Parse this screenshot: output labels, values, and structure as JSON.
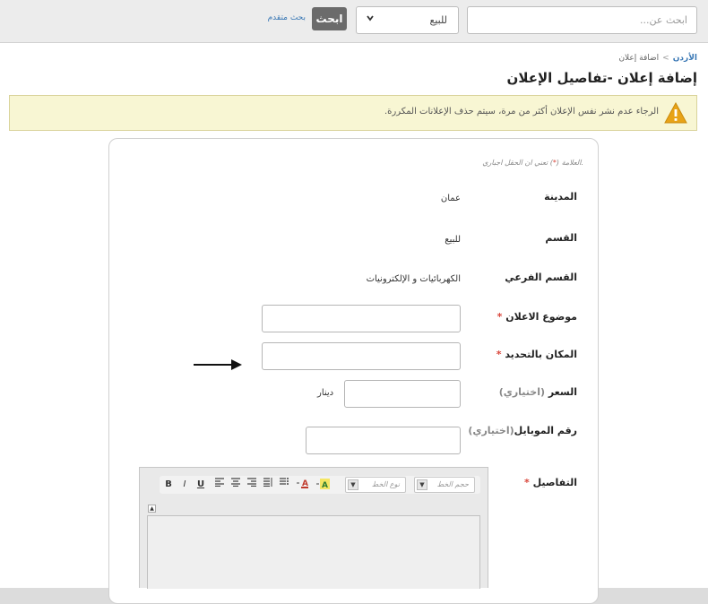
{
  "colors": {
    "accent": "#3a78b5",
    "required_star": "#d9463b",
    "warning_bg": "#f8f6d3",
    "search_button_bg": "#6b6b6b"
  },
  "search": {
    "placeholder": "ابحث عن...",
    "category_selected": "للبيع",
    "button_label": "ابحث",
    "advanced_link": "بحث متقدم"
  },
  "breadcrumb": {
    "home": "الأردن",
    "separator": ">",
    "current": "اضافة إعلان"
  },
  "page_title": "إضافة إعلان -تفاصيل الإعلان",
  "warning": {
    "icon": "warning-triangle-icon",
    "text": "الرجاء عدم نشر نفس الإعلان أكثر من مرة، سيتم حذف الإعلانات المكررة."
  },
  "form": {
    "required_note_prefix": "العلامة (",
    "required_note_star": "*",
    "required_note_suffix": ") تعني ان الحقل اجباري.",
    "city_label": "المدينة",
    "city_value": "عمان",
    "section_label": "القسم",
    "section_value": "للبيع",
    "subsection_label": "القسم الفرعي",
    "subsection_value": "الكهربائيات و الإلكترونيات",
    "title_label": "موضوع الاعلان",
    "location_label": "المكان بالتحديد",
    "price_label": "السعر",
    "price_optional": "(اختياري)",
    "price_unit": "دينار",
    "mobile_label": "رقم الموبايل",
    "mobile_optional": "(اختياري)",
    "details_label": "التفاصيل",
    "star": "*"
  },
  "editor": {
    "font_size_placeholder": "حجم الخط",
    "font_type_placeholder": "نوع الخط",
    "bold": "B",
    "italic": "I",
    "underline": "U",
    "collapse": "▲",
    "dropdown_arrow": "▼"
  }
}
